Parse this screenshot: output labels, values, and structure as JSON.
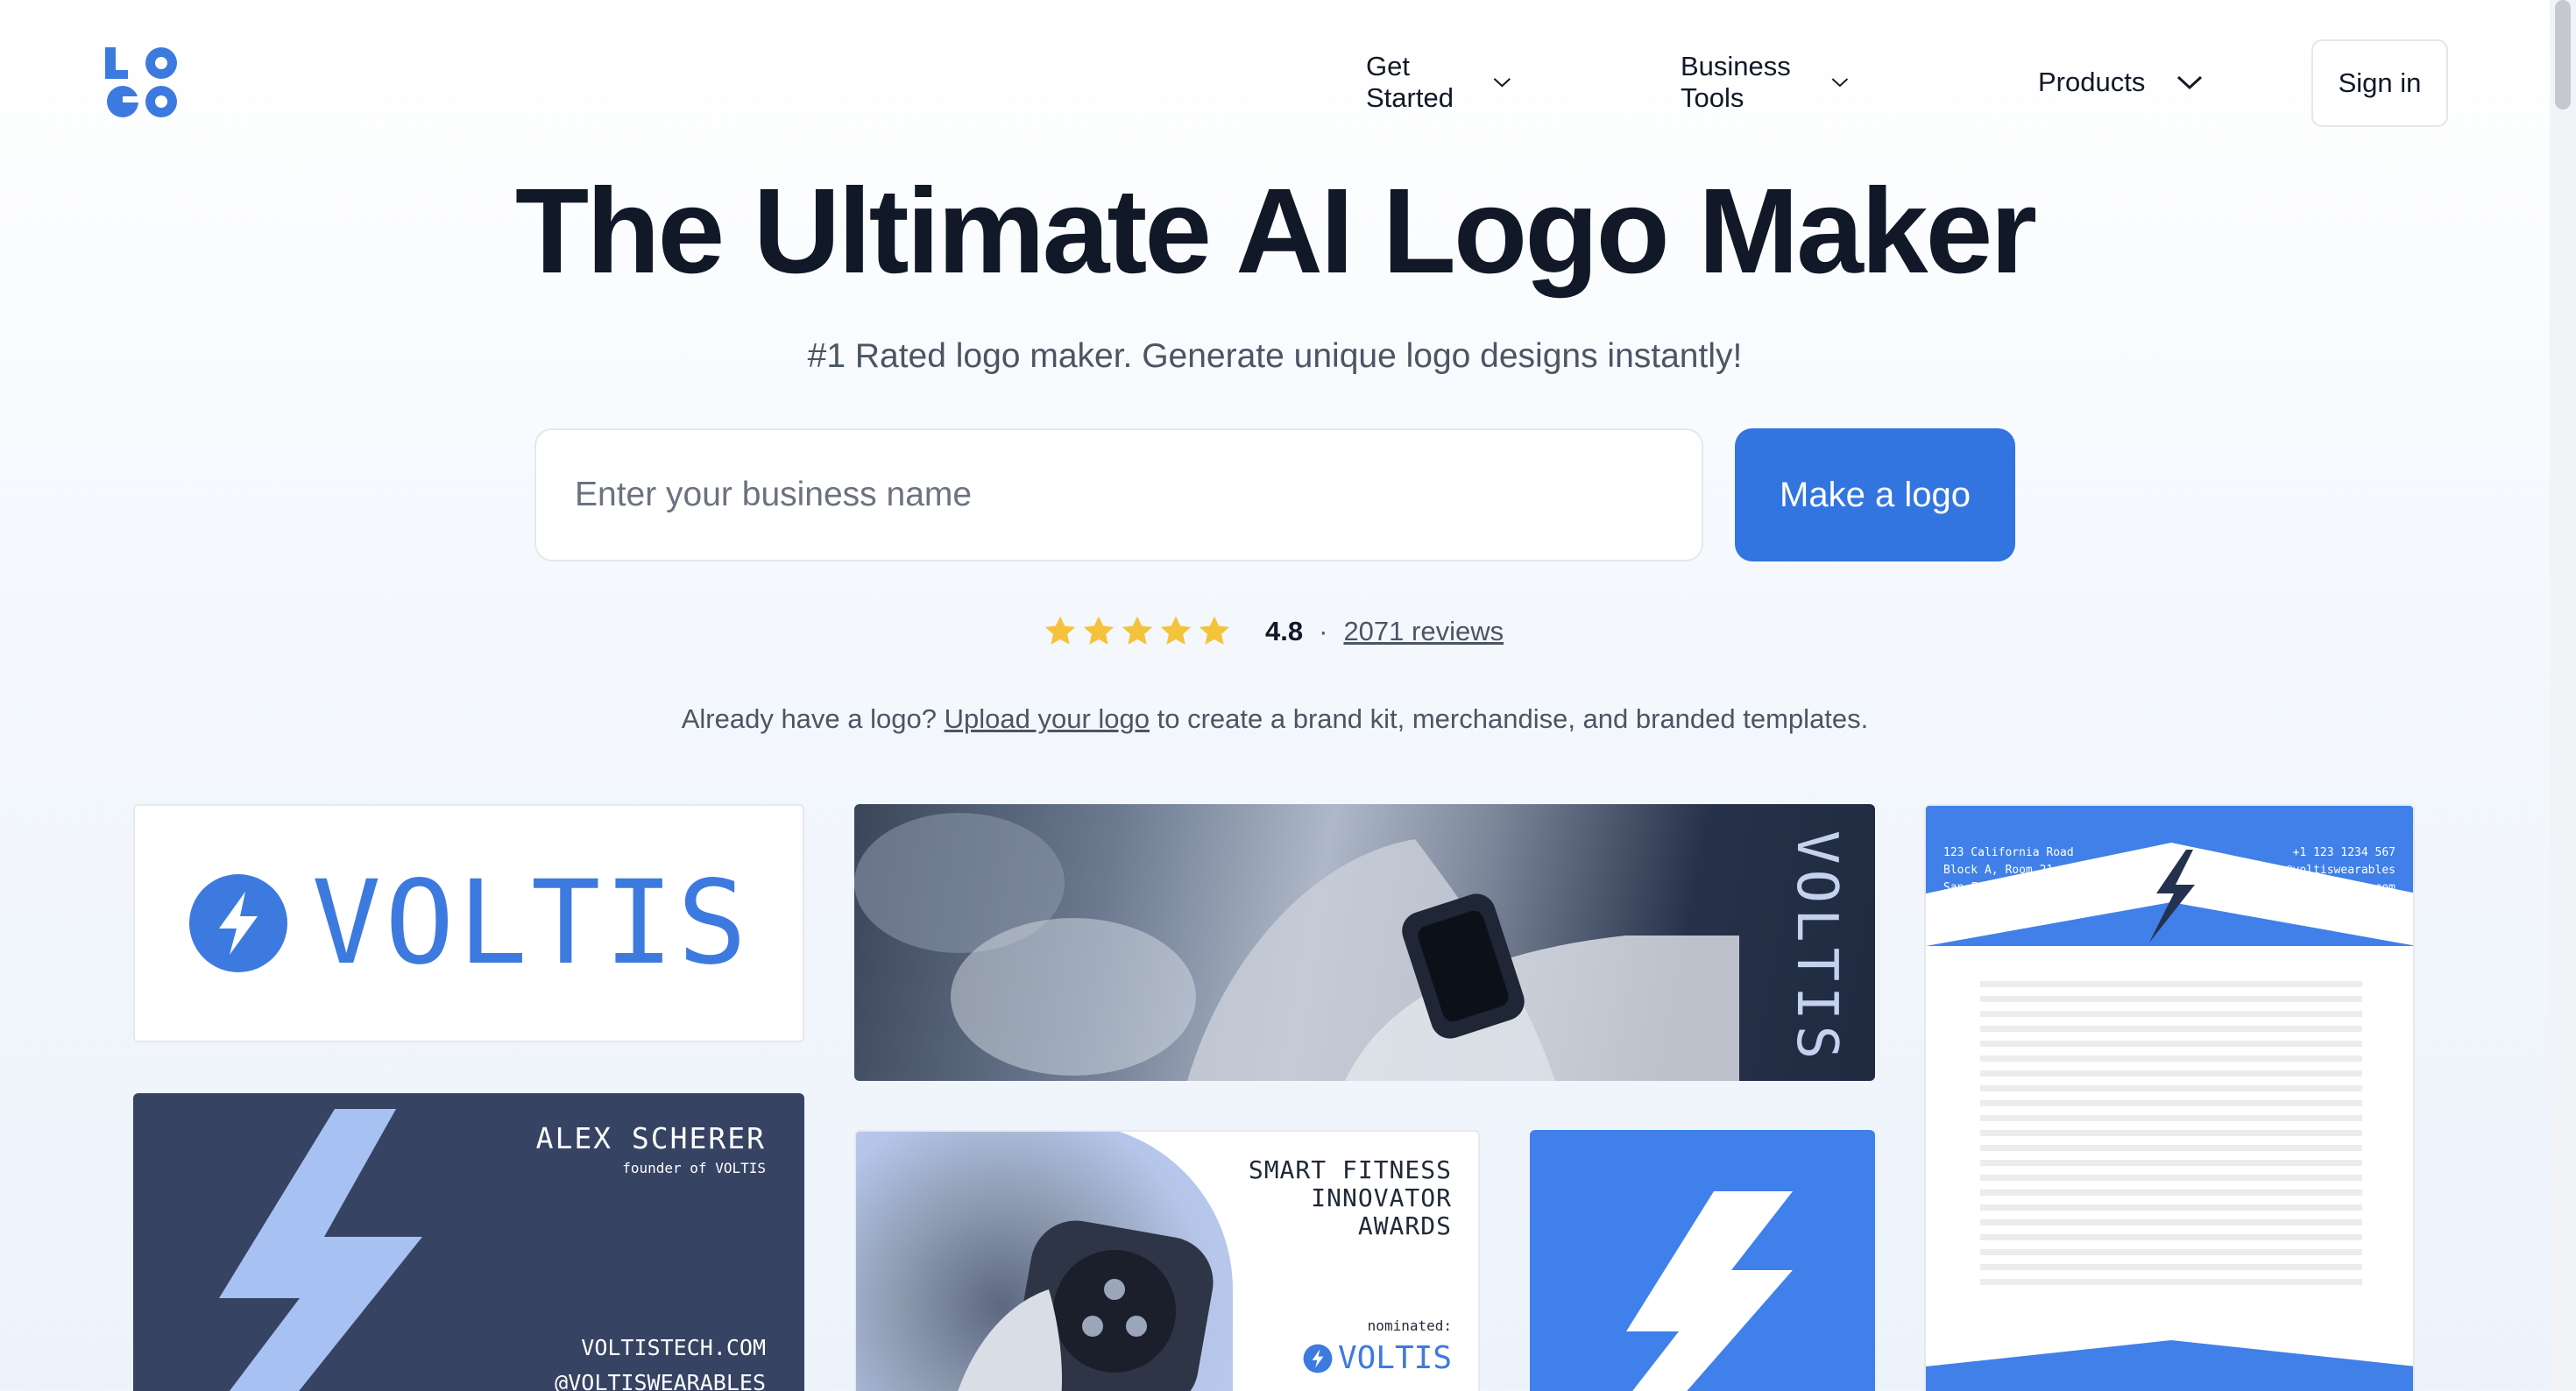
{
  "header": {
    "logo_text": "LOGO",
    "nav": [
      {
        "label": "Get Started",
        "icon": "chevron-down-icon"
      },
      {
        "label": "Business Tools",
        "icon": "chevron-down-icon"
      },
      {
        "label": "Products",
        "icon": "chevron-down-icon"
      }
    ],
    "signin_label": "Sign in"
  },
  "hero": {
    "title": "The Ultimate AI Logo Maker",
    "subtitle": "#1 Rated logo maker. Generate unique logo designs instantly!",
    "input_placeholder": "Enter your business name",
    "input_value": "",
    "cta_label": "Make a logo"
  },
  "rating": {
    "stars": 5,
    "value": "4.8",
    "separator": "·",
    "reviews_label": "2071 reviews"
  },
  "upload": {
    "prefix": "Already have a logo?",
    "link_label": "Upload your logo",
    "suffix": "to create a brand kit, merchandise, and branded templates."
  },
  "showcase": {
    "logo_card": {
      "wordmark": "VOLTIS"
    },
    "photo_card": {
      "wordmark": "VOLTIS"
    },
    "letterhead": {
      "address": [
        "123 California Road",
        "Block A, Room 21",
        "San Francisco"
      ],
      "contact": [
        "+1 123 1234 567",
        "@voltiswearables",
        "voltistech.com"
      ]
    },
    "business_card": {
      "name": "ALEX SCHERER",
      "role": "founder of VOLTIS",
      "website": "VOLTISTECH.COM",
      "handle": "@VOLTISWEARABLES"
    },
    "award_card": {
      "title_lines": [
        "SMART FITNESS",
        "INNOVATOR",
        "AWARDS"
      ],
      "nominated": "nominated:",
      "wordmark": "VOLTIS"
    }
  },
  "colors": {
    "brand_blue": "#3375e0",
    "logo_blue": "#3d7ae0",
    "card_navy": "#374362",
    "star_yellow": "#f5c33b"
  }
}
